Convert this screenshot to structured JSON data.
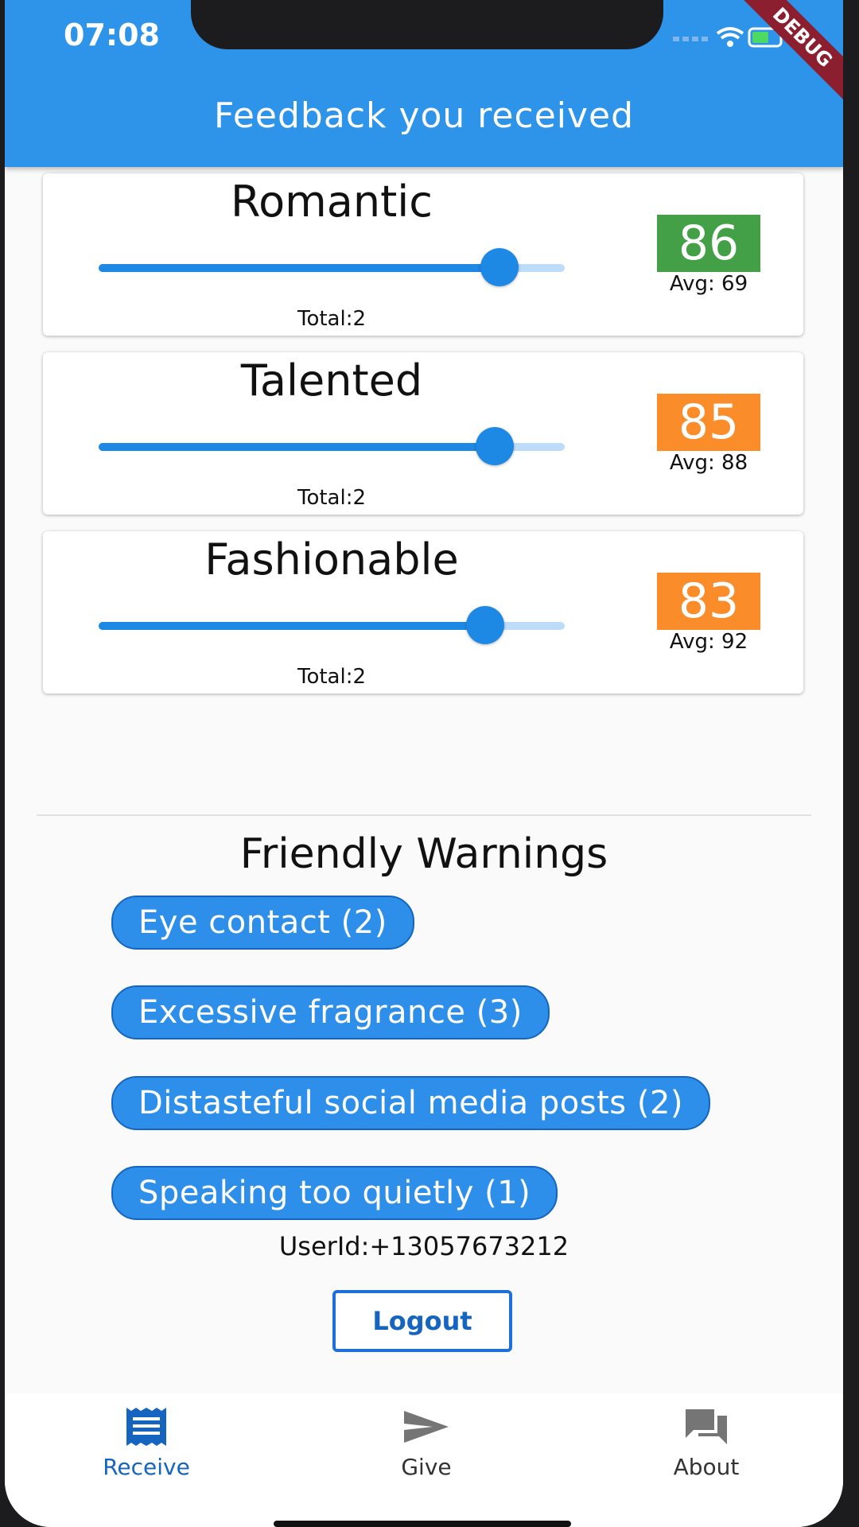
{
  "status_bar": {
    "time": "07:08",
    "debug_label": "DEBUG"
  },
  "app_bar": {
    "title": "Feedback you received"
  },
  "ratings": [
    {
      "name": "Romantic",
      "value": 86,
      "avg_label": "Avg: 69",
      "total_label": "Total:2",
      "color": "#43a047",
      "slider_fraction": 0.86
    },
    {
      "name": "Talented",
      "value": 85,
      "avg_label": "Avg: 88",
      "total_label": "Total:2",
      "color": "#fb8c2a",
      "slider_fraction": 0.85
    },
    {
      "name": "Fashionable",
      "value": 83,
      "avg_label": "Avg: 92",
      "total_label": "Total:2",
      "color": "#fb8c2a",
      "slider_fraction": 0.83
    }
  ],
  "warnings": {
    "title": "Friendly Warnings",
    "items": [
      "Eye contact (2)",
      "Excessive fragrance (3)",
      "Distasteful social media posts (2)",
      "Speaking too quietly (1)"
    ]
  },
  "user": {
    "id_label": "UserId:+13057673212"
  },
  "logout_label": "Logout",
  "bottom_nav": {
    "items": [
      {
        "label": "Receive",
        "icon": "receipt-icon",
        "active": true
      },
      {
        "label": "Give",
        "icon": "send-icon",
        "active": false
      },
      {
        "label": "About",
        "icon": "forum-icon",
        "active": false
      }
    ]
  },
  "colors": {
    "primary": "#2e94ea",
    "active_nav": "#1565c0",
    "inactive_nav": "#333333"
  }
}
